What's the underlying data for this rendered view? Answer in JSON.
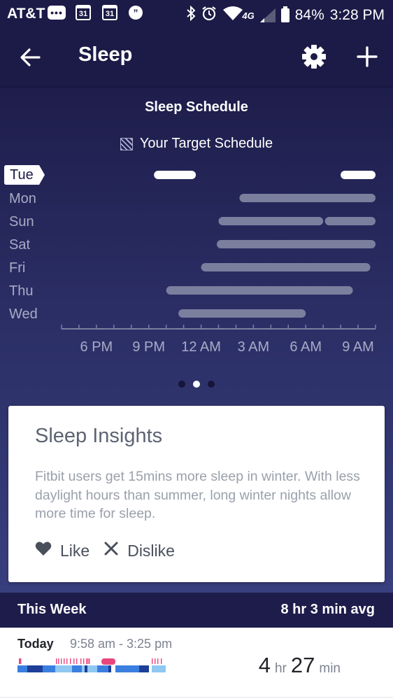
{
  "status_bar": {
    "carrier": "AT&T",
    "calendar_day_1": "31",
    "calendar_day_2": "31",
    "network": "4G",
    "battery": "84%",
    "time": "3:28 PM",
    "icons": [
      "message-icon",
      "calendar-icon",
      "calendar-icon",
      "hangouts-icon",
      "bluetooth-icon",
      "alarm-icon",
      "wifi-icon",
      "signal-icon",
      "battery-icon"
    ]
  },
  "app_bar": {
    "title": "Sleep",
    "icons": [
      "back-arrow-icon",
      "gear-icon",
      "plus-icon"
    ]
  },
  "schedule": {
    "title": "Sleep Schedule",
    "legend_label": "Your Target Schedule",
    "highlight_day": "Tue",
    "colors": {
      "target_bar": "#ffffff",
      "sleep_bar": "#7b7f9e",
      "axis": "#7a7ea0",
      "label": "#a8abc6"
    },
    "axis_labels": [
      "6 PM",
      "9 PM",
      "12 AM",
      "3 AM",
      "6 AM",
      "9 AM"
    ],
    "axis_start_hour": 16,
    "axis_end_hour": 34,
    "target_segments": [
      {
        "start_hour": 21.3,
        "end_hour": 23.7
      },
      {
        "start_hour": 32.0,
        "end_hour": 34.0
      }
    ],
    "days": [
      {
        "label": "Mon",
        "segments": [
          {
            "start_hour": 26.2,
            "end_hour": 34.0
          }
        ]
      },
      {
        "label": "Sun",
        "segments": [
          {
            "start_hour": 25.0,
            "end_hour": 31.0
          },
          {
            "start_hour": 31.1,
            "end_hour": 34.0
          }
        ]
      },
      {
        "label": "Sat",
        "segments": [
          {
            "start_hour": 24.9,
            "end_hour": 34.0
          }
        ]
      },
      {
        "label": "Fri",
        "segments": [
          {
            "start_hour": 24.0,
            "end_hour": 33.7
          }
        ]
      },
      {
        "label": "Thu",
        "segments": [
          {
            "start_hour": 22.0,
            "end_hour": 32.7
          }
        ]
      },
      {
        "label": "Wed",
        "segments": [
          {
            "start_hour": 22.7,
            "end_hour": 30.0
          }
        ]
      }
    ]
  },
  "pager": {
    "total": 3,
    "active_index": 1
  },
  "insights": {
    "title": "Sleep Insights",
    "body": "Fitbit users get 15mins more sleep in winter. With less daylight hours than summer, long winter nights allow more time for sleep.",
    "like_label": "Like",
    "dislike_label": "Dislike",
    "icons": [
      "heart-icon",
      "close-icon"
    ]
  },
  "this_week": {
    "label": "This Week",
    "average": "8 hr 3 min avg"
  },
  "today": {
    "day": "Today",
    "range": "9:58 am - 3:25 pm",
    "hours": "4",
    "hours_unit": "hr",
    "minutes": "27",
    "minutes_unit": "min",
    "stage_colors": {
      "awake": "#e8467c",
      "rem": "#8fc8f2",
      "light": "#3a7fe0",
      "deep": "#1e3f98"
    }
  }
}
